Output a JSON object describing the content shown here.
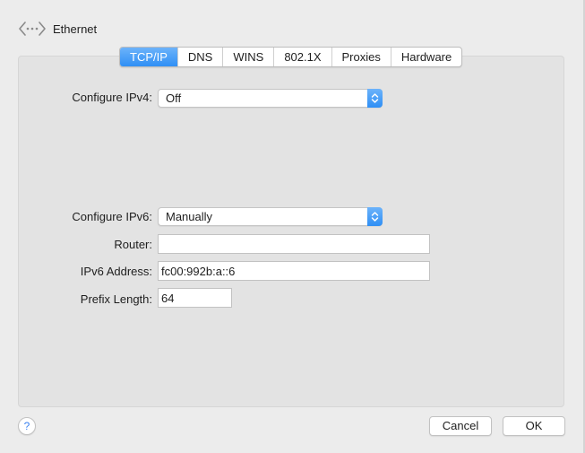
{
  "header": {
    "title": "Ethernet",
    "icon": "network-ethernet-icon"
  },
  "tabs": [
    {
      "label": "TCP/IP",
      "active": true
    },
    {
      "label": "DNS",
      "active": false
    },
    {
      "label": "WINS",
      "active": false
    },
    {
      "label": "802.1X",
      "active": false
    },
    {
      "label": "Proxies",
      "active": false
    },
    {
      "label": "Hardware",
      "active": false
    }
  ],
  "ipv4": {
    "label": "Configure IPv4:",
    "value": "Off"
  },
  "ipv6": {
    "label": "Configure IPv6:",
    "value": "Manually"
  },
  "router": {
    "label": "Router:",
    "value": ""
  },
  "ipv6_address": {
    "label": "IPv6 Address:",
    "value": "fc00:992b:a::6"
  },
  "prefix_length": {
    "label": "Prefix Length:",
    "value": "64"
  },
  "footer": {
    "help_label": "?",
    "cancel_label": "Cancel",
    "ok_label": "OK"
  },
  "colors": {
    "accent": "#2f8ff5",
    "background": "#ececec",
    "panel": "#e3e3e3"
  }
}
